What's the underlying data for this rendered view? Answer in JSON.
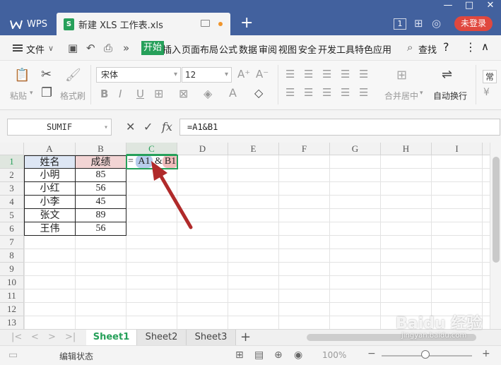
{
  "titlebar": {
    "app_label": "WPS",
    "doc_tab_label": "新建 XLS 工作表.xls",
    "new_tab": "+",
    "win_controls": [
      "—",
      "□",
      "✕"
    ],
    "badge_count": "1",
    "login_label": "未登录"
  },
  "menubar": {
    "file_label": "文件",
    "items": [
      "开始",
      "插入",
      "页面布局",
      "公式",
      "数据",
      "审阅",
      "视图",
      "安全",
      "开发工具",
      "特色应用"
    ],
    "find_label": "查找",
    "help_label": "?",
    "more_label": "⋮",
    "collapse_label": "∧"
  },
  "ribbon": {
    "paste_label": "粘贴",
    "format_painter_label": "格式刷",
    "font_name": "宋体",
    "font_size": "12",
    "grow_font": "A⁺",
    "shrink_font": "A⁻",
    "bold": "B",
    "italic": "I",
    "underline": "U",
    "merge_label": "合并居中",
    "wrap_label": "自动换行",
    "number_format": "常"
  },
  "formula_bar": {
    "name_box": "SUMIF",
    "cancel": "✕",
    "confirm": "✓",
    "fx": "fx",
    "formula": "=A1&B1"
  },
  "sheet": {
    "columns": [
      "A",
      "B",
      "C",
      "D",
      "E",
      "F",
      "G",
      "H",
      "I"
    ],
    "rows": [
      "1",
      "2",
      "3",
      "4",
      "5",
      "6",
      "7",
      "8",
      "9",
      "10",
      "11",
      "12",
      "13"
    ],
    "active_column": "C",
    "active_row": "1",
    "table": {
      "header": [
        "姓名",
        "成绩"
      ],
      "rows": [
        [
          "小明",
          "85"
        ],
        [
          "小红",
          "56"
        ],
        [
          "小李",
          "45"
        ],
        [
          "张文",
          "89"
        ],
        [
          "王伟",
          "56"
        ]
      ]
    },
    "c1_formula": {
      "prefix": "= ",
      "ref_a": "A1",
      "amp": " &",
      "ref_b": "B1"
    }
  },
  "sheet_tabs": {
    "tabs": [
      "Sheet1",
      "Sheet2",
      "Sheet3"
    ],
    "active": "Sheet1",
    "add": "+"
  },
  "statusbar": {
    "status_text": "编辑状态",
    "zoom": "100%",
    "zoom_out": "−",
    "zoom_in": "+"
  },
  "watermark": {
    "text": "Baidu 经验",
    "url": "jingyan.baidu.com"
  },
  "colors": {
    "title_bg": "#42619e",
    "accent_green": "#26a05a",
    "login_red": "#e0483e",
    "ref_a_bg": "#b8cdec",
    "ref_b_bg": "#f0bcbc",
    "arrow": "#b02a2a"
  }
}
